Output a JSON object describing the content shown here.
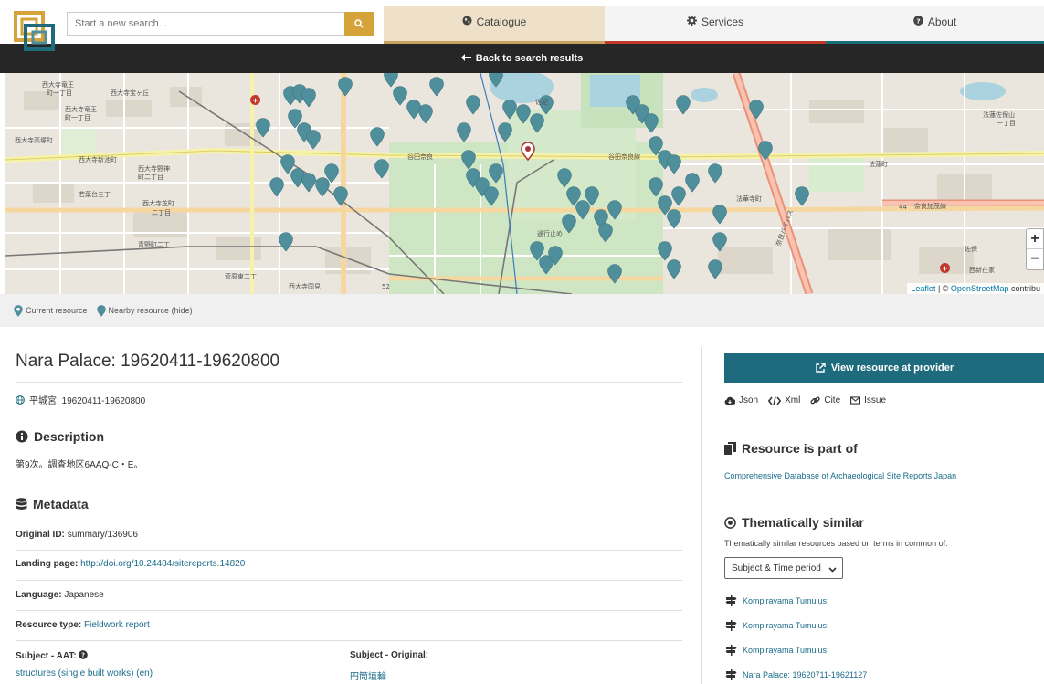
{
  "header": {
    "search_placeholder": "Start a new search...",
    "nav": [
      {
        "label": "Catalogue"
      },
      {
        "label": "Services"
      },
      {
        "label": "About"
      }
    ],
    "back_label": "Back to search results"
  },
  "map": {
    "attribution_leaflet": "Leaflet",
    "attribution_sep": " | © ",
    "attribution_osm": "OpenStreetMap",
    "attribution_tail": " contribu",
    "zoom_in": "+",
    "zoom_out": "−",
    "labels": {
      "l1": "西大寺宝ヶ丘",
      "l2": "西大寺竜王",
      "l3": "町一丁目",
      "l4": "西大寺高塚町",
      "l5": "西大寺新池町",
      "l6": "西大寺野神",
      "l7": "町二丁目",
      "l8": "若葉台三丁",
      "l9": "西大寺芝町",
      "l10": "二丁目",
      "l11": "青野町二丁",
      "l12": "菅原東二丁",
      "l13": "西大寺国見",
      "l14": "谷田奈良",
      "l15": "佐紀",
      "l16": "法華寺町",
      "l17": "法蓮町",
      "l18": "法蓮佐保山",
      "l19": "一丁目",
      "l20": "奈良加茂線",
      "l21": "佐保",
      "l22": "西新在家",
      "l23": "谷田奈良線",
      "l24": "44",
      "l25": "52",
      "l26": "通行止め",
      "l27": "奈良バイパス"
    }
  },
  "legend": {
    "current": "Current resource",
    "nearby": "Nearby resource",
    "hide": "(hide)"
  },
  "resource": {
    "title": "Nara Palace: 19620411-19620800",
    "alt_title": "平城宮: 19620411-19620800",
    "description_heading": "Description",
    "description": "第9次。調査地区6AAQ-C・E。",
    "metadata_heading": "Metadata",
    "original_id_label": "Original ID:",
    "original_id": "summary/136906",
    "landing_label": "Landing page:",
    "landing_url": "http://doi.org/10.24484/sitereports.14820",
    "language_label": "Language:",
    "language": "Japanese",
    "type_label": "Resource type:",
    "type": "Fieldwork report",
    "subject_aat_label": "Subject - AAT:",
    "subject_aat": "structures (single built works) (en)",
    "subject_orig_label": "Subject - Original:",
    "subject_orig": "円筒埴輪"
  },
  "sidebar": {
    "view_button": "View resource at provider",
    "exports": [
      "Json",
      "Xml",
      "Cite",
      "Issue"
    ],
    "part_of_heading": "Resource is part of",
    "part_of_link": "Comprehensive Database of Archaeological Site Reports Japan",
    "similar_heading": "Thematically similar",
    "similar_desc": "Thematically similar resources based on terms in common of:",
    "similar_select": "Subject & Time period",
    "similar_items": [
      "Kompirayama Tumulus:",
      "Kompirayama Tumulus:",
      "Kompirayama Tumulus:",
      "Nara Palace: 19620711-19621127"
    ]
  },
  "colors": {
    "pin": "#4f8f9b",
    "accent_teal": "#1f6b7e",
    "search_btn": "#d6a23a",
    "catalogue_tab": "#eee0c9"
  }
}
